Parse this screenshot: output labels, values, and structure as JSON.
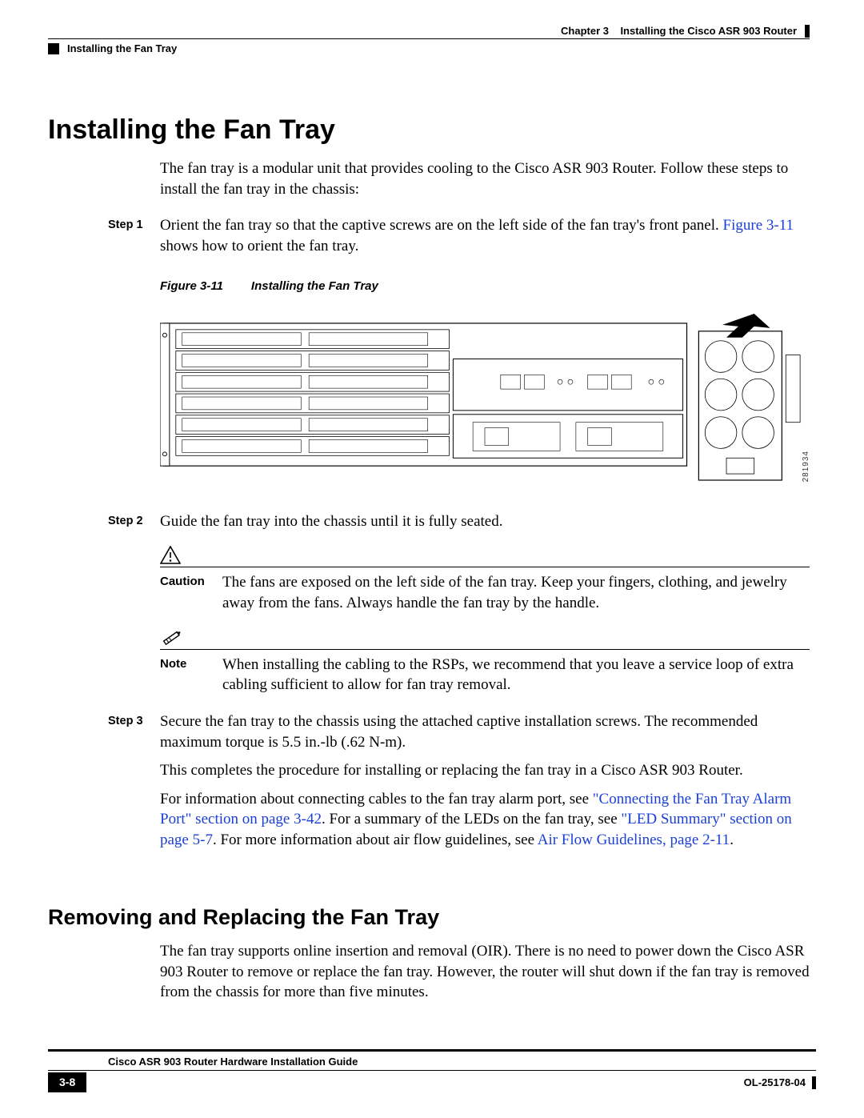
{
  "header": {
    "chapter_label": "Chapter 3",
    "chapter_title": "Installing the Cisco ASR 903 Router",
    "section_crumb": "Installing the Fan Tray"
  },
  "h1": "Installing the Fan Tray",
  "intro": "The fan tray is a modular unit that provides cooling to the Cisco ASR 903 Router. Follow these steps to install the fan tray in the chassis:",
  "steps": {
    "s1_label": "Step 1",
    "s1_text_a": "Orient the fan tray so that the captive screws are on the left side of the fan tray's front panel. ",
    "s1_link": "Figure 3-11",
    "s1_text_b": " shows how to orient the fan tray.",
    "s2_label": "Step 2",
    "s2_text": "Guide the fan tray into the chassis until it is fully seated.",
    "s3_label": "Step 3",
    "s3_text": "Secure the fan tray to the chassis using the attached captive installation screws. The recommended maximum torque is 5.5 in.-lb (.62 N-m).",
    "s3_p2": "This completes the procedure for installing or replacing the fan tray in a Cisco ASR 903 Router.",
    "s3_p3_a": "For information about connecting cables to the fan tray alarm port, see ",
    "s3_link1": "\"Connecting the Fan Tray Alarm Port\" section on page 3-42",
    "s3_p3_b": ". For a summary of the LEDs on the fan tray, see ",
    "s3_link2": "\"LED Summary\" section on page 5-7",
    "s3_p3_c": ". For more information about air flow guidelines, see ",
    "s3_link3": "Air Flow Guidelines, page 2-11",
    "s3_p3_d": "."
  },
  "figure": {
    "label": "Figure 3-11",
    "caption": "Installing the Fan Tray",
    "id": "281934"
  },
  "caution": {
    "label": "Caution",
    "text": "The fans are exposed on the left side of the fan tray. Keep your fingers, clothing, and jewelry away from the fans. Always handle the fan tray by the handle."
  },
  "note": {
    "label": "Note",
    "text": "When installing the cabling to the RSPs, we recommend that you leave a service loop of extra cabling sufficient to allow for fan tray removal."
  },
  "h2": "Removing and Replacing the Fan Tray",
  "p_remove": "The fan tray supports online insertion and removal (OIR). There is no need to power down the Cisco ASR 903 Router to remove or replace the fan tray. However, the router will shut down if the fan tray is removed from the chassis for more than five minutes.",
  "footer": {
    "guide": "Cisco ASR 903 Router Hardware Installation Guide",
    "page": "3-8",
    "docid": "OL-25178-04"
  }
}
